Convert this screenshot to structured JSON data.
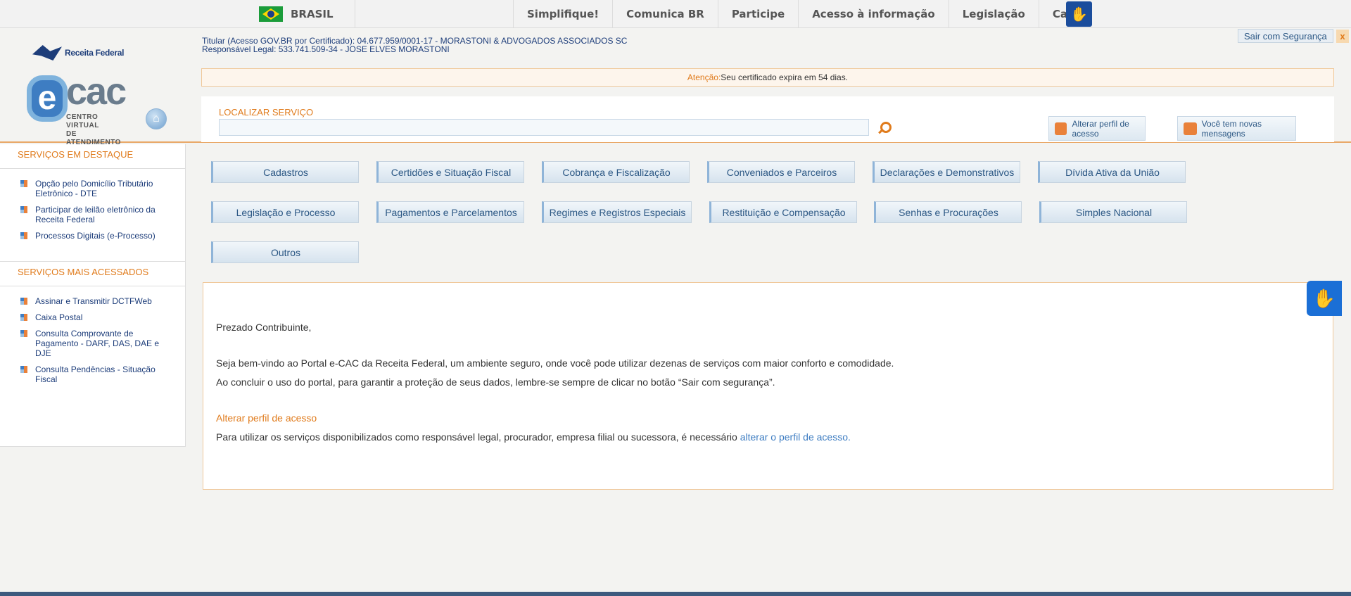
{
  "govbar": {
    "country": "BRASIL",
    "nav": [
      "Simplifique!",
      "Comunica BR",
      "Participe",
      "Acesso à informação",
      "Legislação",
      "Canais"
    ]
  },
  "header": {
    "rf_logo_text": "Receita Federal",
    "ecac_e": "e",
    "ecac_cac": "cac",
    "ecac_subtitle": "CENTRO VIRTUAL\nDE ATENDIMENTO",
    "titular": "Titular (Acesso GOV.BR por Certificado): 04.677.959/0001-17 - MORASTONI & ADVOGADOS ASSOCIADOS SC",
    "responsavel": "Responsável Legal: 533.741.509-34 - JOSE ELVES MORASTONI",
    "exit_label": "Sair com Segurança",
    "exit_close": "x"
  },
  "alert": {
    "label": "Atenção:",
    "message": "Seu certificado expira em 54 dias."
  },
  "search": {
    "label": "LOCALIZAR SERVIÇO",
    "value": "",
    "placeholder": ""
  },
  "tools": {
    "perfil": "Alterar perfil de acesso",
    "mensagens": "Você tem novas mensagens"
  },
  "sidebar": {
    "destaque_title": "SERVIÇOS EM DESTAQUE",
    "destaque": [
      "Opção pelo Domicílio Tributário Eletrônico - DTE",
      "Participar de leilão eletrônico da Receita Federal",
      "Processos Digitais (e-Processo)"
    ],
    "acessados_title": "SERVIÇOS MAIS ACESSADOS",
    "acessados": [
      "Assinar e Transmitir DCTFWeb",
      "Caixa Postal",
      "Consulta Comprovante de Pagamento - DARF, DAS, DAE e DJE",
      "Consulta Pendências - Situação Fiscal"
    ]
  },
  "categories": [
    "Cadastros",
    "Certidões e Situação Fiscal",
    "Cobrança e Fiscalização",
    "Conveniados e Parceiros",
    "Declarações e Demonstrativos",
    "Dívida Ativa da União",
    "Legislação e Processo",
    "Pagamentos e Parcelamentos",
    "Regimes e Registros Especiais",
    "Restituição e Compensação",
    "Senhas e Procurações",
    "Simples Nacional",
    "Outros"
  ],
  "welcome": {
    "greeting": "Prezado Contribuinte,",
    "p1": "Seja bem-vindo ao Portal e-CAC da Receita Federal, um ambiente seguro, onde você pode utilizar dezenas de serviços com maior conforto e comodidade.",
    "p2": "Ao concluir o uso do portal, para garantir a proteção de seus dados, lembre-se sempre de clicar no botão “Sair com segurança”.",
    "heading": "Alterar perfil de acesso",
    "p3": "Para utilizar os serviços disponibilizados como responsável legal, procurador, empresa filial ou sucessora, é necessário ",
    "p3_link": "alterar o perfil de acesso."
  },
  "icons": {
    "libras": "hand-sign-icon",
    "home": "home-icon",
    "search": "search-icon",
    "perfil": "users-icon",
    "mensagens": "envelope-icon"
  },
  "colors": {
    "accent_orange": "#e07b1c",
    "link_blue": "#2b5784",
    "libras_blue": "#1b6fd6"
  }
}
